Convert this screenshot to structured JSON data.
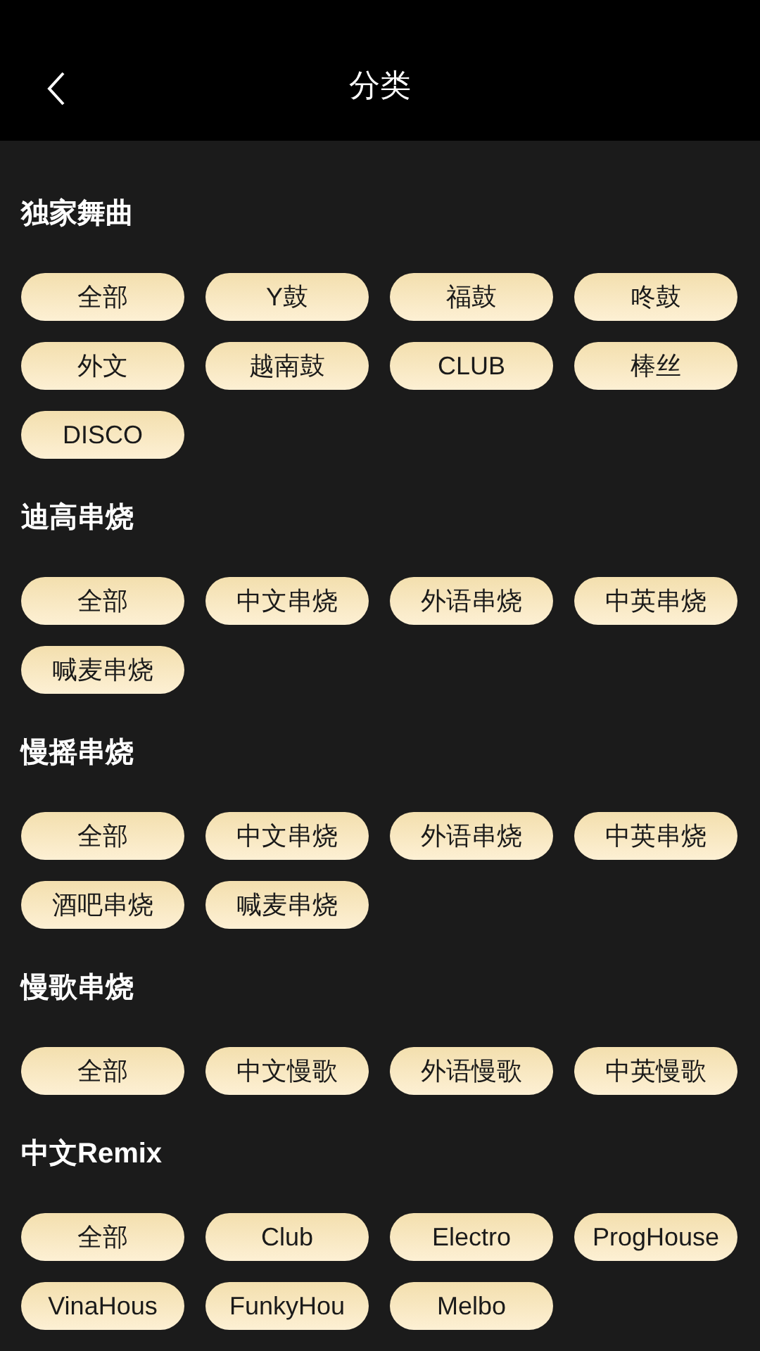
{
  "header": {
    "title": "分类"
  },
  "sections": [
    {
      "title": "独家舞曲",
      "tags": [
        "全部",
        "Y鼓",
        "福鼓",
        "咚鼓",
        "外文",
        "越南鼓",
        "CLUB",
        "棒丝",
        "DISCO"
      ]
    },
    {
      "title": "迪高串烧",
      "tags": [
        "全部",
        "中文串烧",
        "外语串烧",
        "中英串烧",
        "喊麦串烧"
      ]
    },
    {
      "title": "慢摇串烧",
      "tags": [
        "全部",
        "中文串烧",
        "外语串烧",
        "中英串烧",
        "酒吧串烧",
        "喊麦串烧"
      ]
    },
    {
      "title": "慢歌串烧",
      "tags": [
        "全部",
        "中文慢歌",
        "外语慢歌",
        "中英慢歌"
      ]
    },
    {
      "title": "中文Remix",
      "tags": [
        "全部",
        "Club",
        "Electro",
        "ProgHouse",
        "VinaHous",
        "FunkyHou",
        "Melbo"
      ]
    }
  ]
}
